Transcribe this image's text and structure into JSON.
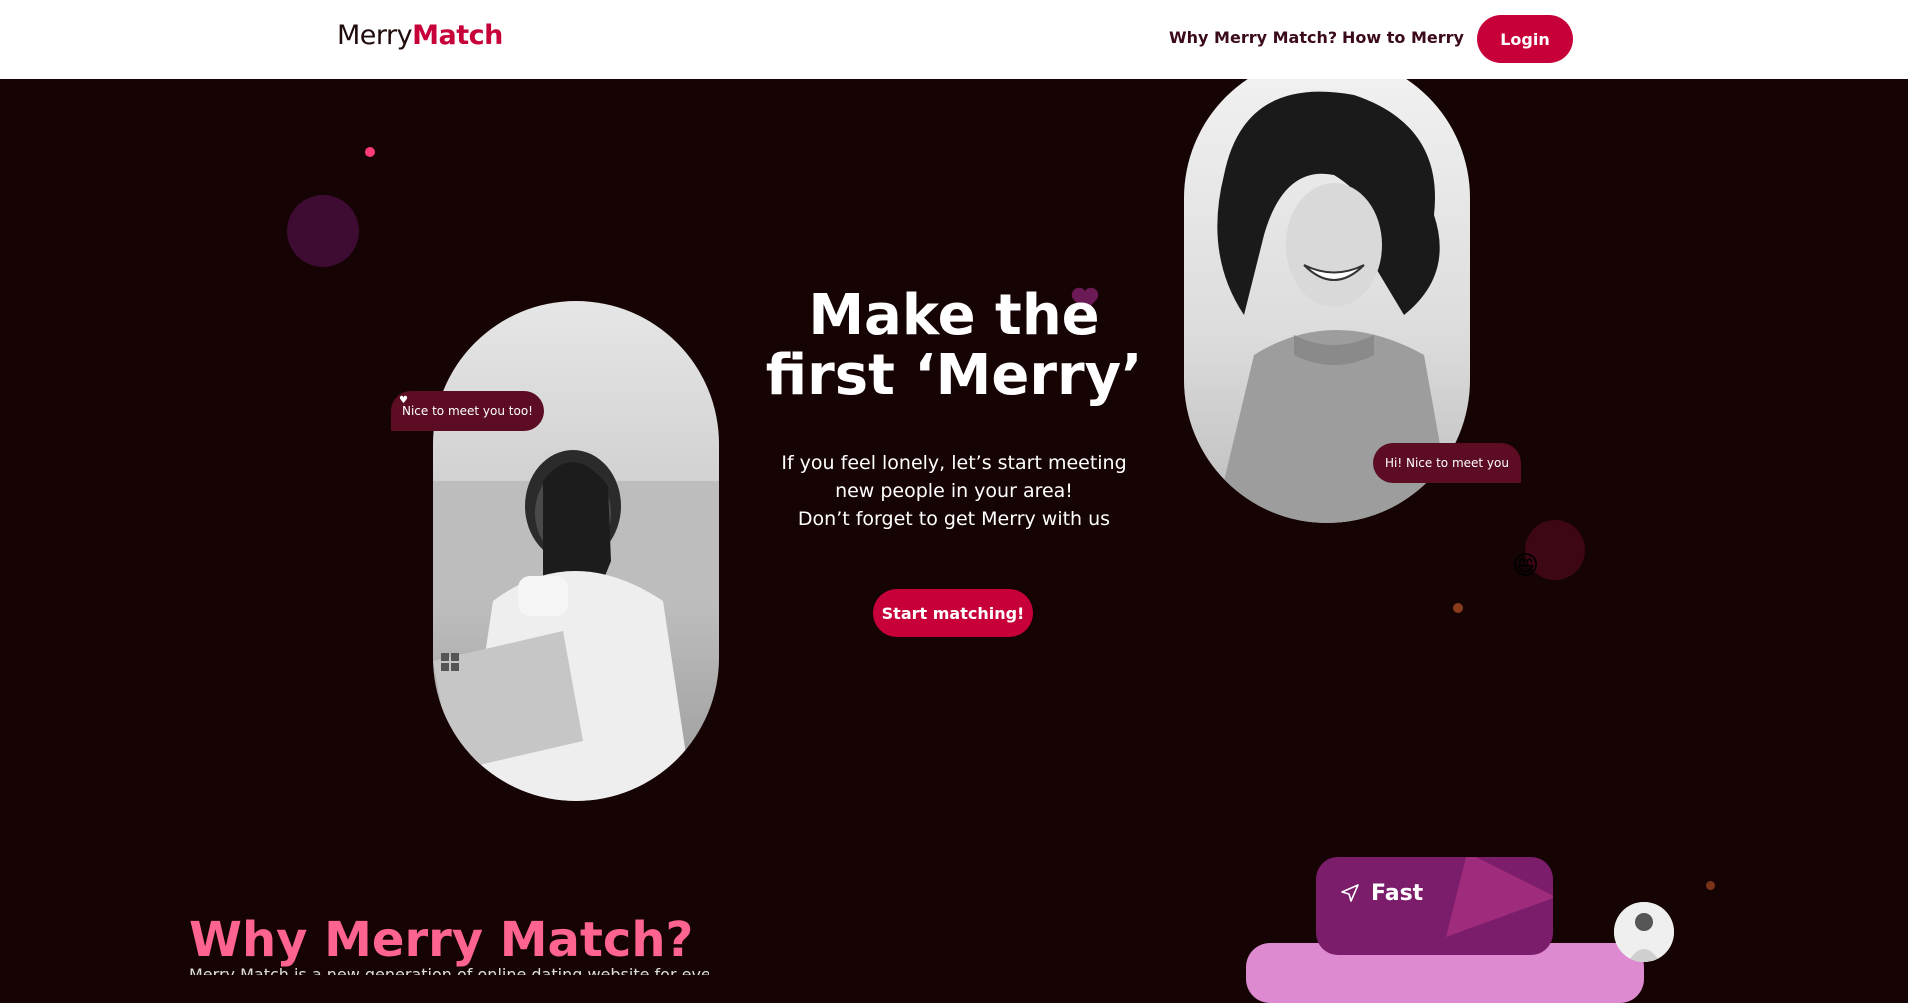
{
  "header": {
    "logo_part1": "Merry",
    "logo_part2": "Match",
    "nav": {
      "why": "Why Merry Match?",
      "how": "How to Merry"
    },
    "login_label": "Login"
  },
  "hero": {
    "title": "Make the\nfirst ‘Merry’",
    "subtitle_line1": "If you feel lonely, let’s start meeting",
    "subtitle_line2": "new people in your area!",
    "subtitle_line3": "Don’t forget to get Merry with us",
    "cta_label": "Start matching!",
    "bubble_left": "Nice to meet you too!",
    "bubble_right": "Hi! Nice to meet you",
    "emoji": "😄"
  },
  "why_section": {
    "title": "Why Merry Match?",
    "description": "Merry Match is a new generation of online dating website for everyone"
  },
  "feature_card": {
    "label": "Fast"
  },
  "colors": {
    "brand": "#c70039",
    "background": "#160404",
    "accent_pink": "#ff6390",
    "card_purple": "#7b1d6b"
  }
}
